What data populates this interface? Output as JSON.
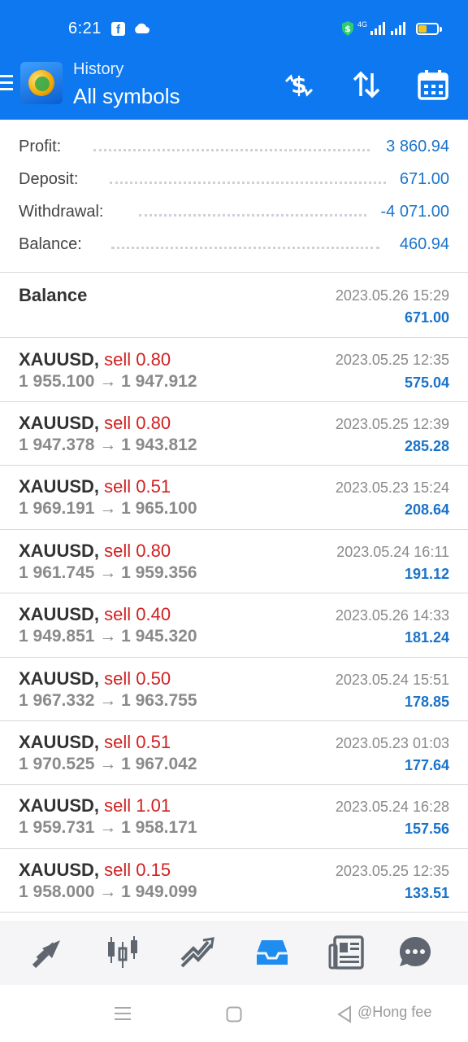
{
  "status_bar": {
    "time": "6:21",
    "network_label": "4G",
    "icons": [
      "facebook-icon",
      "cloud-icon",
      "shield-dollar-icon",
      "signal-icon",
      "signal-icon",
      "battery-icon"
    ]
  },
  "header": {
    "subtitle": "History",
    "title": "All symbols",
    "actions": [
      "currency-exchange-icon",
      "sort-icon",
      "calendar-icon"
    ]
  },
  "summary": [
    {
      "label": "Profit:",
      "value": "3 860.94"
    },
    {
      "label": "Deposit:",
      "value": "671.00"
    },
    {
      "label": "Withdrawal:",
      "value": "-4 071.00"
    },
    {
      "label": "Balance:",
      "value": "460.94"
    }
  ],
  "balance_entry": {
    "title": "Balance",
    "date": "2023.05.26 15:29",
    "amount": "671.00"
  },
  "deals": [
    {
      "symbol": "XAUUSD,",
      "side": "sell 0.80",
      "prices": "1 955.100 → 1 947.912",
      "date": "2023.05.25 12:35",
      "profit": "575.04"
    },
    {
      "symbol": "XAUUSD,",
      "side": "sell 0.80",
      "prices": "1 947.378 → 1 943.812",
      "date": "2023.05.25 12:39",
      "profit": "285.28"
    },
    {
      "symbol": "XAUUSD,",
      "side": "sell 0.51",
      "prices": "1 969.191 → 1 965.100",
      "date": "2023.05.23 15:24",
      "profit": "208.64"
    },
    {
      "symbol": "XAUUSD,",
      "side": "sell 0.80",
      "prices": "1 961.745 → 1 959.356",
      "date": "2023.05.24 16:11",
      "profit": "191.12"
    },
    {
      "symbol": "XAUUSD,",
      "side": "sell 0.40",
      "prices": "1 949.851 → 1 945.320",
      "date": "2023.05.26 14:33",
      "profit": "181.24"
    },
    {
      "symbol": "XAUUSD,",
      "side": "sell 0.50",
      "prices": "1 967.332 → 1 963.755",
      "date": "2023.05.24 15:51",
      "profit": "178.85"
    },
    {
      "symbol": "XAUUSD,",
      "side": "sell 0.51",
      "prices": "1 970.525 → 1 967.042",
      "date": "2023.05.23 01:03",
      "profit": "177.64"
    },
    {
      "symbol": "XAUUSD,",
      "side": "sell 1.01",
      "prices": "1 959.731 → 1 958.171",
      "date": "2023.05.24 16:28",
      "profit": "157.56"
    },
    {
      "symbol": "XAUUSD,",
      "side": "sell 0.15",
      "prices": "1 958.000 → 1 949.099",
      "date": "2023.05.25 12:35",
      "profit": "133.51"
    }
  ],
  "bottom_nav": [
    {
      "name": "quotes-icon",
      "active": false
    },
    {
      "name": "chart-icon",
      "active": false
    },
    {
      "name": "trade-icon",
      "active": false
    },
    {
      "name": "history-icon",
      "active": true
    },
    {
      "name": "news-icon",
      "active": false
    },
    {
      "name": "messages-icon",
      "active": false
    }
  ],
  "colors": {
    "header_blue": "#0d78ef",
    "profit_blue": "#1a73c9",
    "sell_red": "#d11f1f",
    "muted_gray": "#8a8a8a"
  },
  "watermark": "@Hong fee"
}
